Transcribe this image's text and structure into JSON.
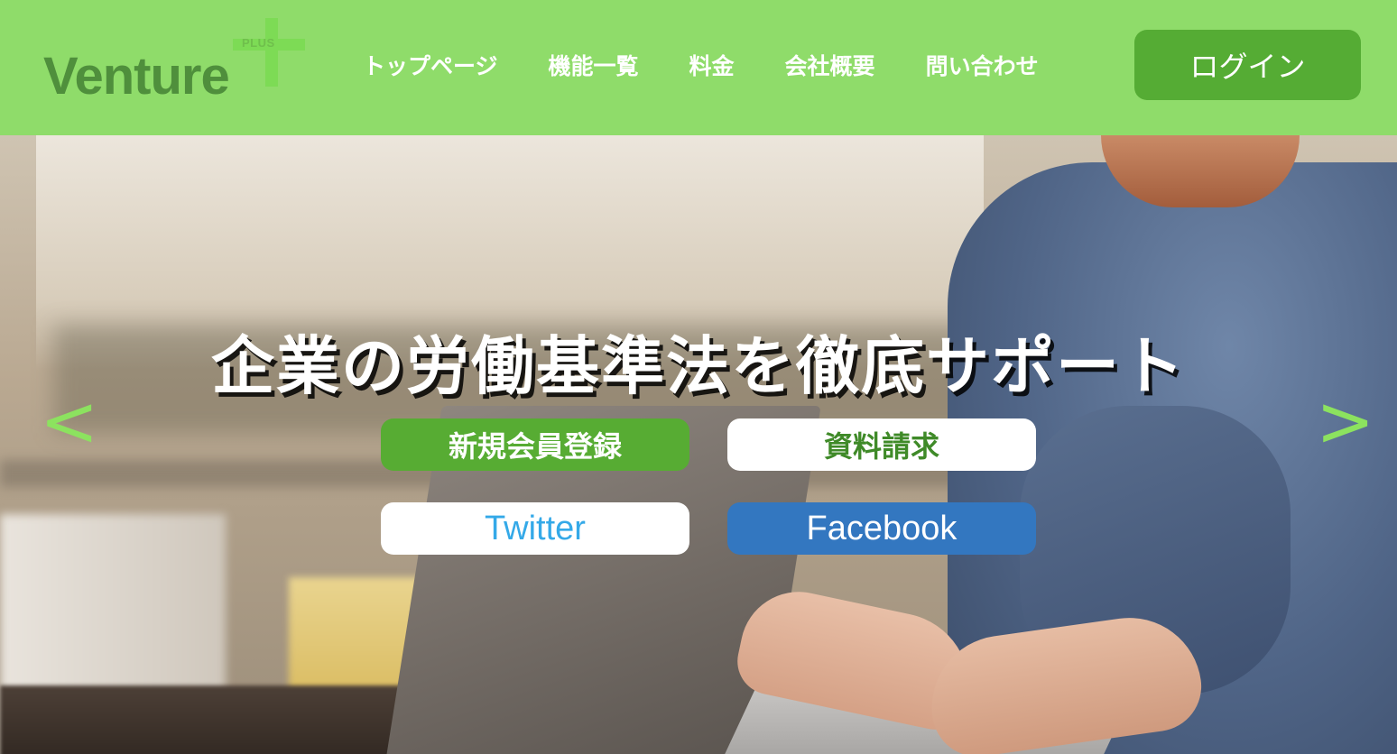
{
  "header": {
    "logo": {
      "text": "Venture",
      "sub": "PLUS"
    },
    "nav": [
      {
        "label": "トップページ"
      },
      {
        "label": "機能一覧"
      },
      {
        "label": "料金"
      },
      {
        "label": "会社概要"
      },
      {
        "label": "問い合わせ"
      }
    ],
    "login_label": "ログイン"
  },
  "hero": {
    "title": "企業の労働基準法を徹底サポート",
    "prev_arrow": "<",
    "next_arrow": ">",
    "buttons": {
      "register": "新規会員登録",
      "docs": "資料請求",
      "twitter": "Twitter",
      "facebook": "Facebook"
    }
  },
  "colors": {
    "header_bg": "#8fdc6a",
    "logo_text": "#4f8f3c",
    "accent_green": "#57ac33",
    "twitter_blue": "#34a9e8",
    "facebook_blue": "#3377c0",
    "arrow_green": "#8ce25f"
  }
}
